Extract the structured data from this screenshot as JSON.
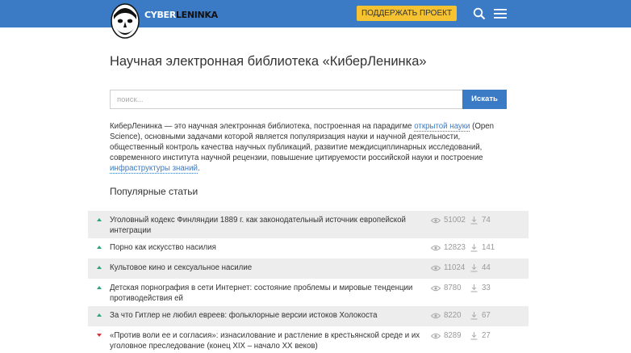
{
  "header": {
    "logo_part1": "CYBER",
    "logo_part2": "LENINKA",
    "support_label": "ПОДДЕРЖАТЬ ПРОЕКТ",
    "search_icon": "search-icon",
    "menu_icon": "hamburger-menu-icon",
    "colors": {
      "bar": "#3b7ac4",
      "support_button": "#f5c332"
    }
  },
  "main": {
    "title": "Научная электронная библиотека «КиберЛенинка»",
    "search": {
      "placeholder": "поиск...",
      "button_label": "Искать"
    },
    "description": {
      "part1": "КиберЛенинка — это научная электронная библиотека, построенная на парадигме ",
      "link1": "открытой науки",
      "part2": " (Open Science), основными задачами которой является популяризация науки и научной деятельности, общественный контроль качества научных публикаций, развитие междисциплинарных исследований, современного института научной рецензии, повышение цитируемости российской науки и построение ",
      "link2": "инфраструктуры знаний",
      "part3": "."
    },
    "popular": {
      "heading": "Популярные статьи",
      "articles": [
        {
          "title": "Уголовный кодекс Финляндии 1889 г. как законодательный источник европейской интеграции",
          "views": "51002",
          "downloads": "74",
          "trend": "up"
        },
        {
          "title": "Порно как искусство насилия",
          "views": "12823",
          "downloads": "141",
          "trend": "up"
        },
        {
          "title": "Культовое кино и сексуальное насилие",
          "views": "11024",
          "downloads": "44",
          "trend": "up"
        },
        {
          "title": "Детская порнография в сети Интернет: состояние проблемы и мировые тенденции противодействия ей",
          "views": "8780",
          "downloads": "33",
          "trend": "up"
        },
        {
          "title": "За что Гитлер не любил евреев: фольклорные версии истоков Холокоста",
          "views": "8220",
          "downloads": "67",
          "trend": "up"
        },
        {
          "title": "«Против воли ее и согласия»: изнасилование и растление в крестьянской среде и их уголовное преследование (конец XIX – начало XX веков)",
          "views": "8289",
          "downloads": "27",
          "trend": "down"
        }
      ]
    }
  }
}
